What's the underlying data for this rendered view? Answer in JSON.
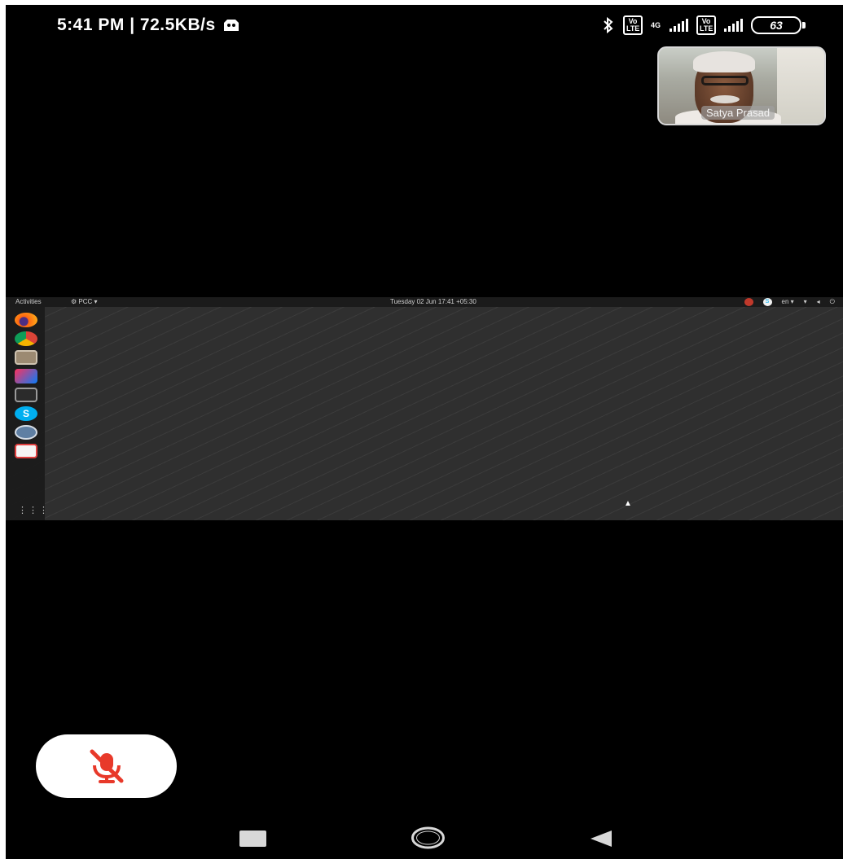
{
  "status_bar": {
    "time_speed": "5:41 PM | 72.5KB/s",
    "network_tag": "4G",
    "volte_label": "Vo LTE",
    "battery_level": "63"
  },
  "self_view": {
    "name": "Satya Prasad"
  },
  "shared_screen": {
    "activities_label": "Activities",
    "app_menu_label": "⚙ PCC ▾",
    "clock_text": "Tuesday 02 Jun 17:41 +05:30",
    "keyboard_label": "en ▾",
    "skype_letter": "S",
    "skype_badge": "S",
    "apps_grid_glyph": "⋮⋮⋮",
    "cursor_glyph": "▲"
  },
  "controls": {
    "mute_icon": "microphone-muted-icon"
  },
  "colors": {
    "mute_red": "#e8392a",
    "background": "#000000"
  }
}
